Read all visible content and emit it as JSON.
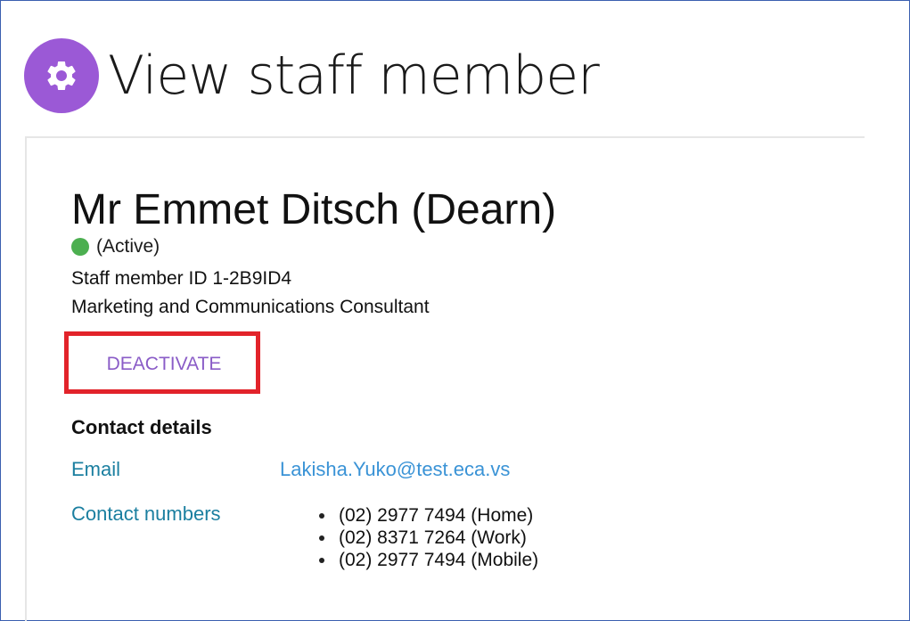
{
  "header": {
    "title": "View staff member",
    "icon": "gear-icon",
    "icon_color": "#9b59d6"
  },
  "staff": {
    "name": "Mr Emmet Ditsch (Dearn)",
    "status": "(Active)",
    "status_color": "#4caf50",
    "staff_id_line": "Staff member ID 1-2B9ID4",
    "job_title": "Marketing and Communications Consultant"
  },
  "actions": {
    "deactivate_label": "DEACTIVATE",
    "highlight_color": "#e2232a"
  },
  "contact": {
    "heading": "Contact details",
    "email_label": "Email",
    "email_value": "Lakisha.Yuko@test.eca.vs",
    "numbers_label": "Contact numbers",
    "numbers": [
      "(02) 2977 7494 (Home)",
      "(02) 8371 7264 (Work)",
      "(02) 2977 7494 (Mobile)"
    ]
  }
}
